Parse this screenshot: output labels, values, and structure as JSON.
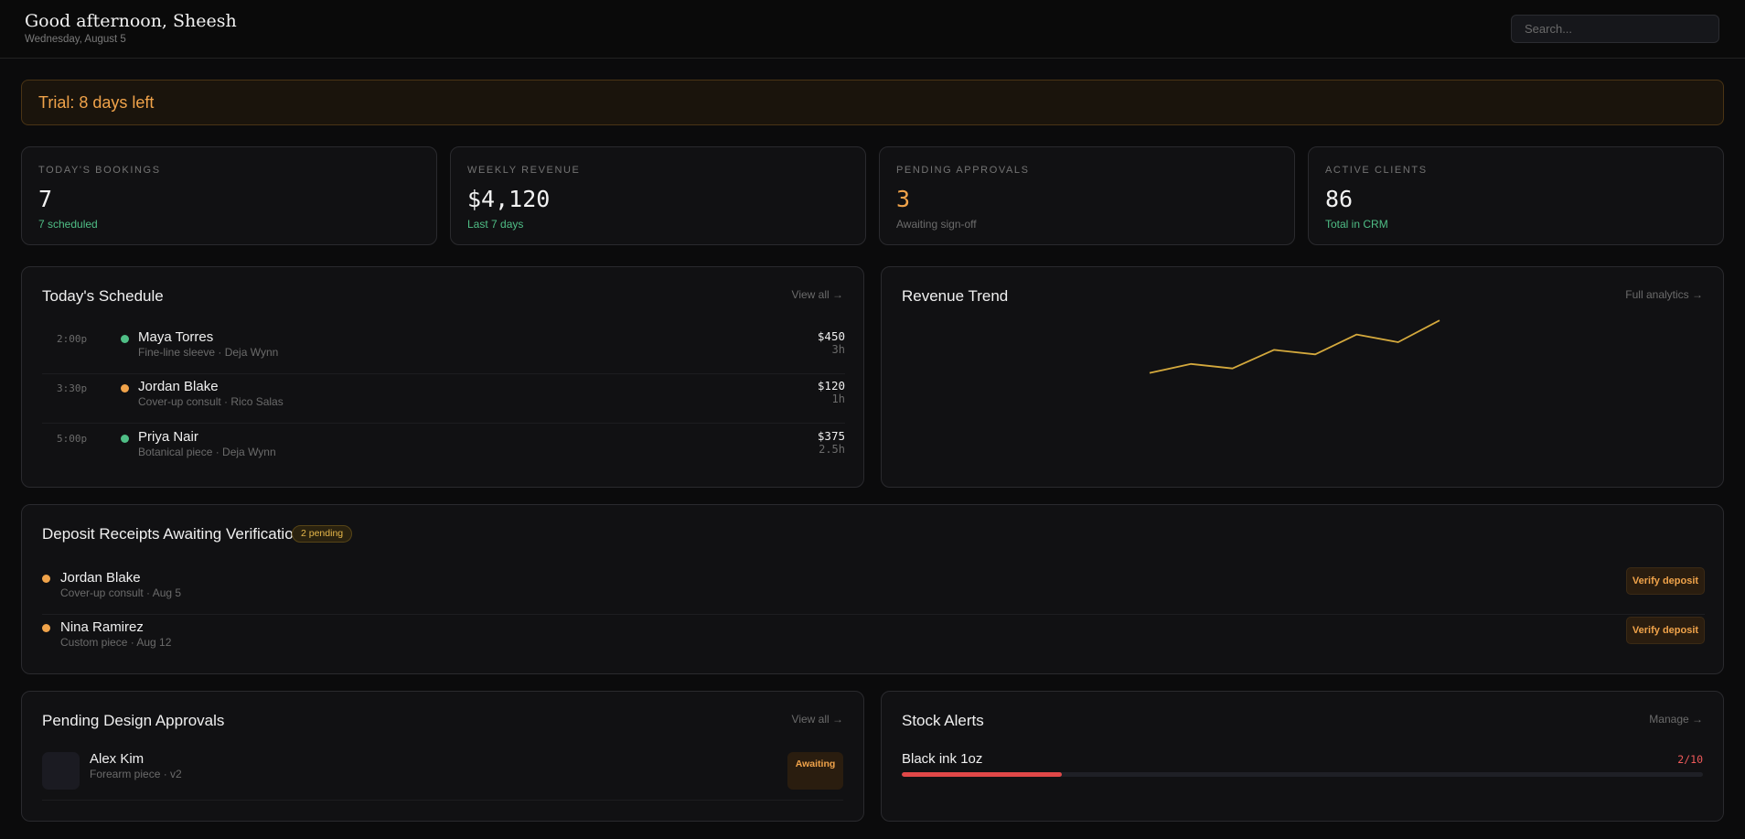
{
  "header": {
    "greeting": "Good afternoon, Sheesh",
    "date": "Wednesday, August 5",
    "search_placeholder": "Search..."
  },
  "trial": {
    "text": "Trial: 8 days left"
  },
  "stats": [
    {
      "label": "TODAY'S BOOKINGS",
      "value": "7",
      "sub": "7 scheduled"
    },
    {
      "label": "WEEKLY REVENUE",
      "value": "$4,120",
      "sub": "Last 7 days"
    },
    {
      "label": "PENDING APPROVALS",
      "value": "3",
      "sub": "Awaiting sign-off"
    },
    {
      "label": "ACTIVE CLIENTS",
      "value": "86",
      "sub": "Total in CRM"
    }
  ],
  "schedule": {
    "title": "Today's Schedule",
    "link": "View all →",
    "items": [
      {
        "time": "2:00p",
        "name": "Maya Torres",
        "desc": "Fine-line sleeve · Deja Wynn",
        "amount": "$450",
        "duration": "3h",
        "status": "green"
      },
      {
        "time": "3:30p",
        "name": "Jordan Blake",
        "desc": "Cover-up consult · Rico Salas",
        "amount": "$120",
        "duration": "1h",
        "status": "orange"
      },
      {
        "time": "5:00p",
        "name": "Priya Nair",
        "desc": "Botanical piece · Deja Wynn",
        "amount": "$375",
        "duration": "2.5h",
        "status": "green"
      }
    ]
  },
  "revenue": {
    "title": "Revenue Trend",
    "link": "Full analytics →",
    "line_color": "#d4a93d"
  },
  "chart_data": {
    "type": "line",
    "x": [
      1,
      2,
      3,
      4,
      5,
      6,
      7,
      8
    ],
    "values": [
      460,
      530,
      495,
      640,
      605,
      760,
      700,
      870
    ],
    "ylim": [
      0,
      1000
    ],
    "grid": false,
    "title": ""
  },
  "deposits": {
    "title": "Deposit Receipts Awaiting Verification",
    "badge": "2 pending",
    "items": [
      {
        "name": "Jordan Blake",
        "desc": "Cover-up consult · Aug 5",
        "action": "Verify deposit"
      },
      {
        "name": "Nina Ramirez",
        "desc": "Custom piece · Aug 12",
        "action": "Verify deposit"
      }
    ]
  },
  "approvals": {
    "title": "Pending Design Approvals",
    "link": "View all →",
    "items": [
      {
        "name": "Alex Kim",
        "desc": "Forearm piece · v2",
        "status": "Awaiting"
      }
    ]
  },
  "stock": {
    "title": "Stock Alerts",
    "link": "Manage →",
    "items": [
      {
        "name": "Black ink 1oz",
        "count": "2/10",
        "current": 2,
        "max": 10
      }
    ]
  },
  "colors": {
    "accent_orange": "#f0a34a",
    "accent_green": "#4fbe86",
    "alert_red": "#e04848"
  }
}
